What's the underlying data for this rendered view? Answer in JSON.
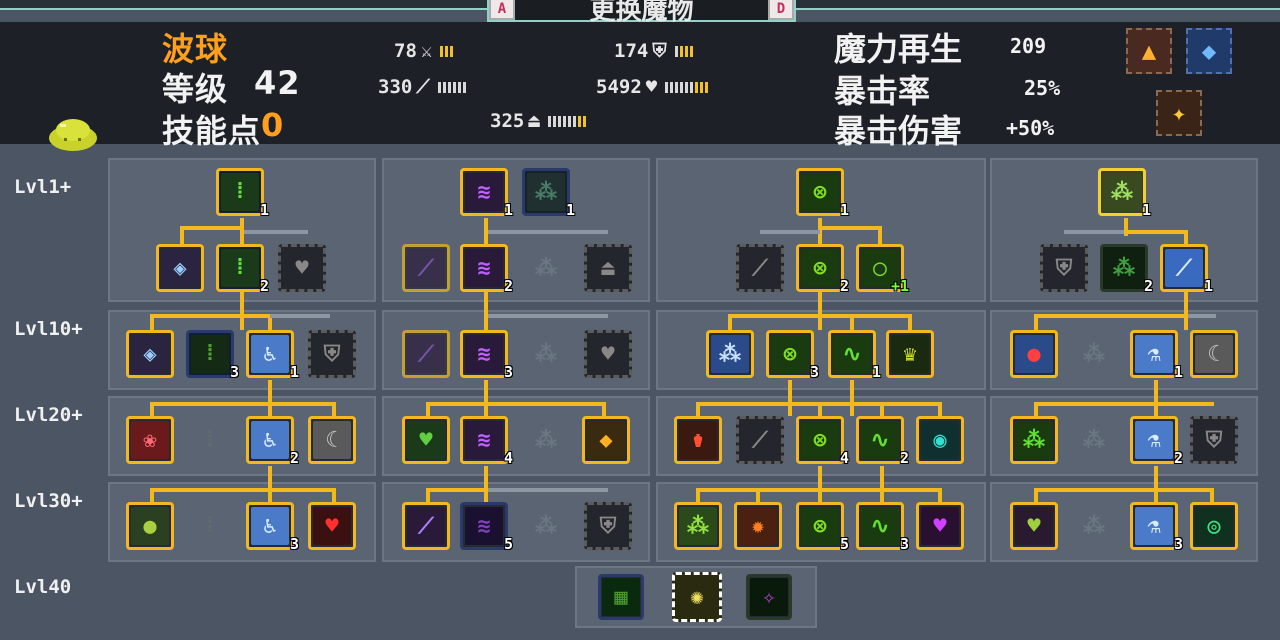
{
  "window": {
    "title": "更换魔物",
    "tab_left_key": "A",
    "tab_right_key": "D"
  },
  "pet": {
    "name": "波球",
    "level_label": "等级",
    "level": "42",
    "skill_points_label": "技能点",
    "skill_points": "0"
  },
  "stats": {
    "attack": "78",
    "defense": "174",
    "attack_speed": "330",
    "hp": "5492",
    "move_speed": "325"
  },
  "right_stats": {
    "mana_regen_label": "魔力再生",
    "mana_regen": "209",
    "crit_rate_label": "暴击率",
    "crit_rate": "25%",
    "crit_damage_label": "暴击伤害",
    "crit_damage": "+50%"
  },
  "rows": {
    "lvl1": "Lvl1+",
    "lvl10": "Lvl10+",
    "lvl20": "Lvl20+",
    "lvl30": "Lvl30+",
    "lvl40": "Lvl40"
  },
  "node_levels": {
    "b1": "1",
    "b1b": "1",
    "c1": "1",
    "d1": "1",
    "a2": "2",
    "b2": "2",
    "c2": "2",
    "c2b": "+1",
    "d2": "2",
    "d2b": "1",
    "a3": "3",
    "a3b": "1",
    "b3": "3",
    "c3": "3",
    "c3b": "1",
    "d3": "1",
    "a4": "2",
    "b4": "4",
    "c4": "4",
    "c4b": "2",
    "d4": "2",
    "a5": "3",
    "b5": "5",
    "c5": "5",
    "c5b": "3",
    "d5": "3"
  },
  "colors": {
    "accent_gold": "#f2b81e",
    "name_orange": "#ff9f1c",
    "header_bg": "#1d2027",
    "panel_bg": "#5a6472"
  }
}
